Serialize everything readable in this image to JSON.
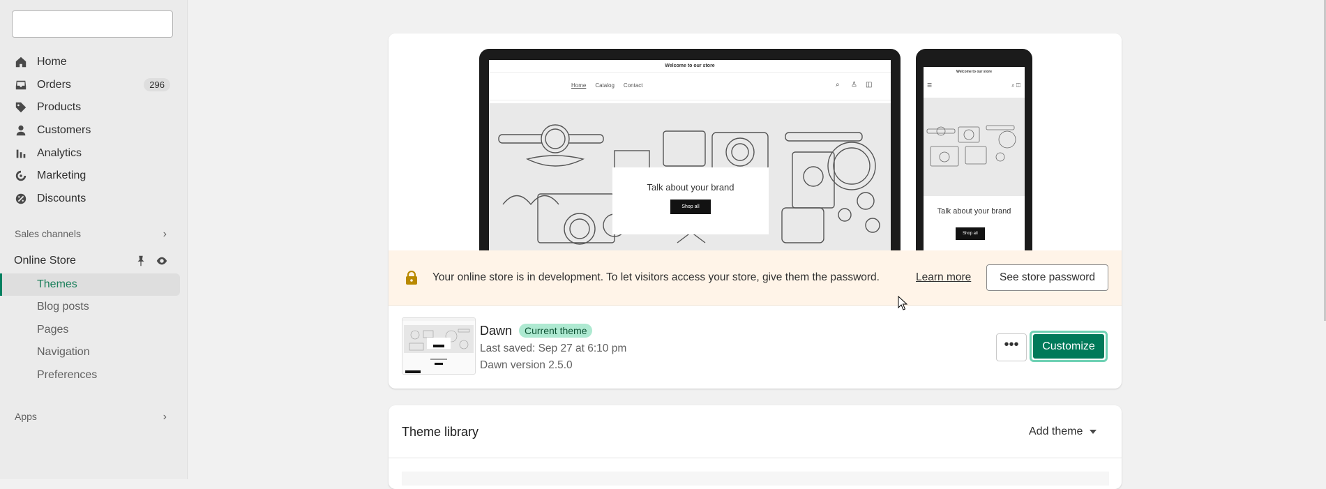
{
  "sidebar": {
    "search": {
      "placeholder": ""
    },
    "nav": [
      {
        "label": "Home",
        "icon": "home-icon"
      },
      {
        "label": "Orders",
        "icon": "inbox-icon",
        "badge": "296"
      },
      {
        "label": "Products",
        "icon": "tag-icon"
      },
      {
        "label": "Customers",
        "icon": "person-icon"
      },
      {
        "label": "Analytics",
        "icon": "bar-chart-icon"
      },
      {
        "label": "Marketing",
        "icon": "target-icon"
      },
      {
        "label": "Discounts",
        "icon": "discount-icon"
      }
    ],
    "sales_channels_label": "Sales channels",
    "online_store": {
      "label": "Online Store",
      "sub_items": [
        "Themes",
        "Blog posts",
        "Pages",
        "Navigation",
        "Preferences"
      ]
    },
    "apps_label": "Apps"
  },
  "preview": {
    "store_banner": "Welcome to our store",
    "nav_links": [
      "Home",
      "Catalog",
      "Contact"
    ],
    "hero_title": "Talk about your brand",
    "hero_button": "Shop all"
  },
  "dev_banner": {
    "message": "Your online store is in development. To let visitors access your store, give them the password.",
    "learn_more": "Learn more",
    "button": "See store password"
  },
  "current_theme": {
    "name": "Dawn",
    "badge": "Current theme",
    "last_saved": "Last saved: Sep 27 at 6:10 pm",
    "version": "Dawn version 2.5.0",
    "more_label": "•••",
    "customize_label": "Customize"
  },
  "theme_library": {
    "title": "Theme library",
    "add_theme": "Add theme"
  },
  "colors": {
    "accent": "#008060",
    "button": "#007a5a",
    "badge_bg": "#aee9d1",
    "warning_bg": "#fff4e8"
  }
}
